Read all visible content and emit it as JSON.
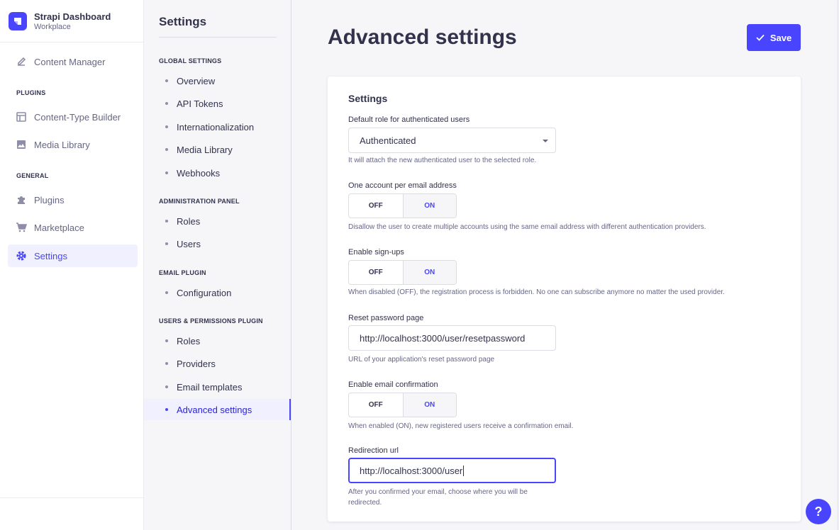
{
  "brand": {
    "name": "Strapi Dashboard",
    "workspace": "Workplace"
  },
  "mainnav": {
    "content_manager": "Content Manager",
    "plugins_section": "PLUGINS",
    "content_type_builder": "Content-Type Builder",
    "media_library": "Media Library",
    "general_section": "GENERAL",
    "plugins": "Plugins",
    "marketplace": "Marketplace",
    "settings": "Settings"
  },
  "subnav": {
    "title": "Settings",
    "sections": [
      {
        "title": "GLOBAL SETTINGS",
        "items": [
          "Overview",
          "API Tokens",
          "Internationalization",
          "Media Library",
          "Webhooks"
        ]
      },
      {
        "title": "ADMINISTRATION PANEL",
        "items": [
          "Roles",
          "Users"
        ]
      },
      {
        "title": "EMAIL PLUGIN",
        "items": [
          "Configuration"
        ]
      },
      {
        "title": "USERS & PERMISSIONS PLUGIN",
        "items": [
          "Roles",
          "Providers",
          "Email templates",
          "Advanced settings"
        ]
      }
    ]
  },
  "page": {
    "title": "Advanced settings",
    "save_label": "Save"
  },
  "form": {
    "card_title": "Settings",
    "default_role": {
      "label": "Default role for authenticated users",
      "value": "Authenticated",
      "hint": "It will attach the new authenticated user to the selected role."
    },
    "one_account": {
      "label": "One account per email address",
      "off": "OFF",
      "on": "ON",
      "hint": "Disallow the user to create multiple accounts using the same email address with different authentication providers."
    },
    "signups": {
      "label": "Enable sign-ups",
      "off": "OFF",
      "on": "ON",
      "hint": "When disabled (OFF), the registration process is forbidden. No one can subscribe anymore no matter the used provider."
    },
    "reset_password": {
      "label": "Reset password page",
      "value": "http://localhost:3000/user/resetpassword",
      "hint": "URL of your application's reset password page"
    },
    "email_confirmation": {
      "label": "Enable email confirmation",
      "off": "OFF",
      "on": "ON",
      "hint": "When enabled (ON), new registered users receive a confirmation email."
    },
    "redirection": {
      "label": "Redirection url",
      "value": "http://localhost:3000/user",
      "hint_line1": "After you confirmed your email, choose where you will be",
      "hint_line2": "redirected."
    }
  },
  "help": {
    "label": "?"
  },
  "colors": {
    "primary": "#4945ff",
    "text": "#32324d",
    "muted": "#666687"
  }
}
